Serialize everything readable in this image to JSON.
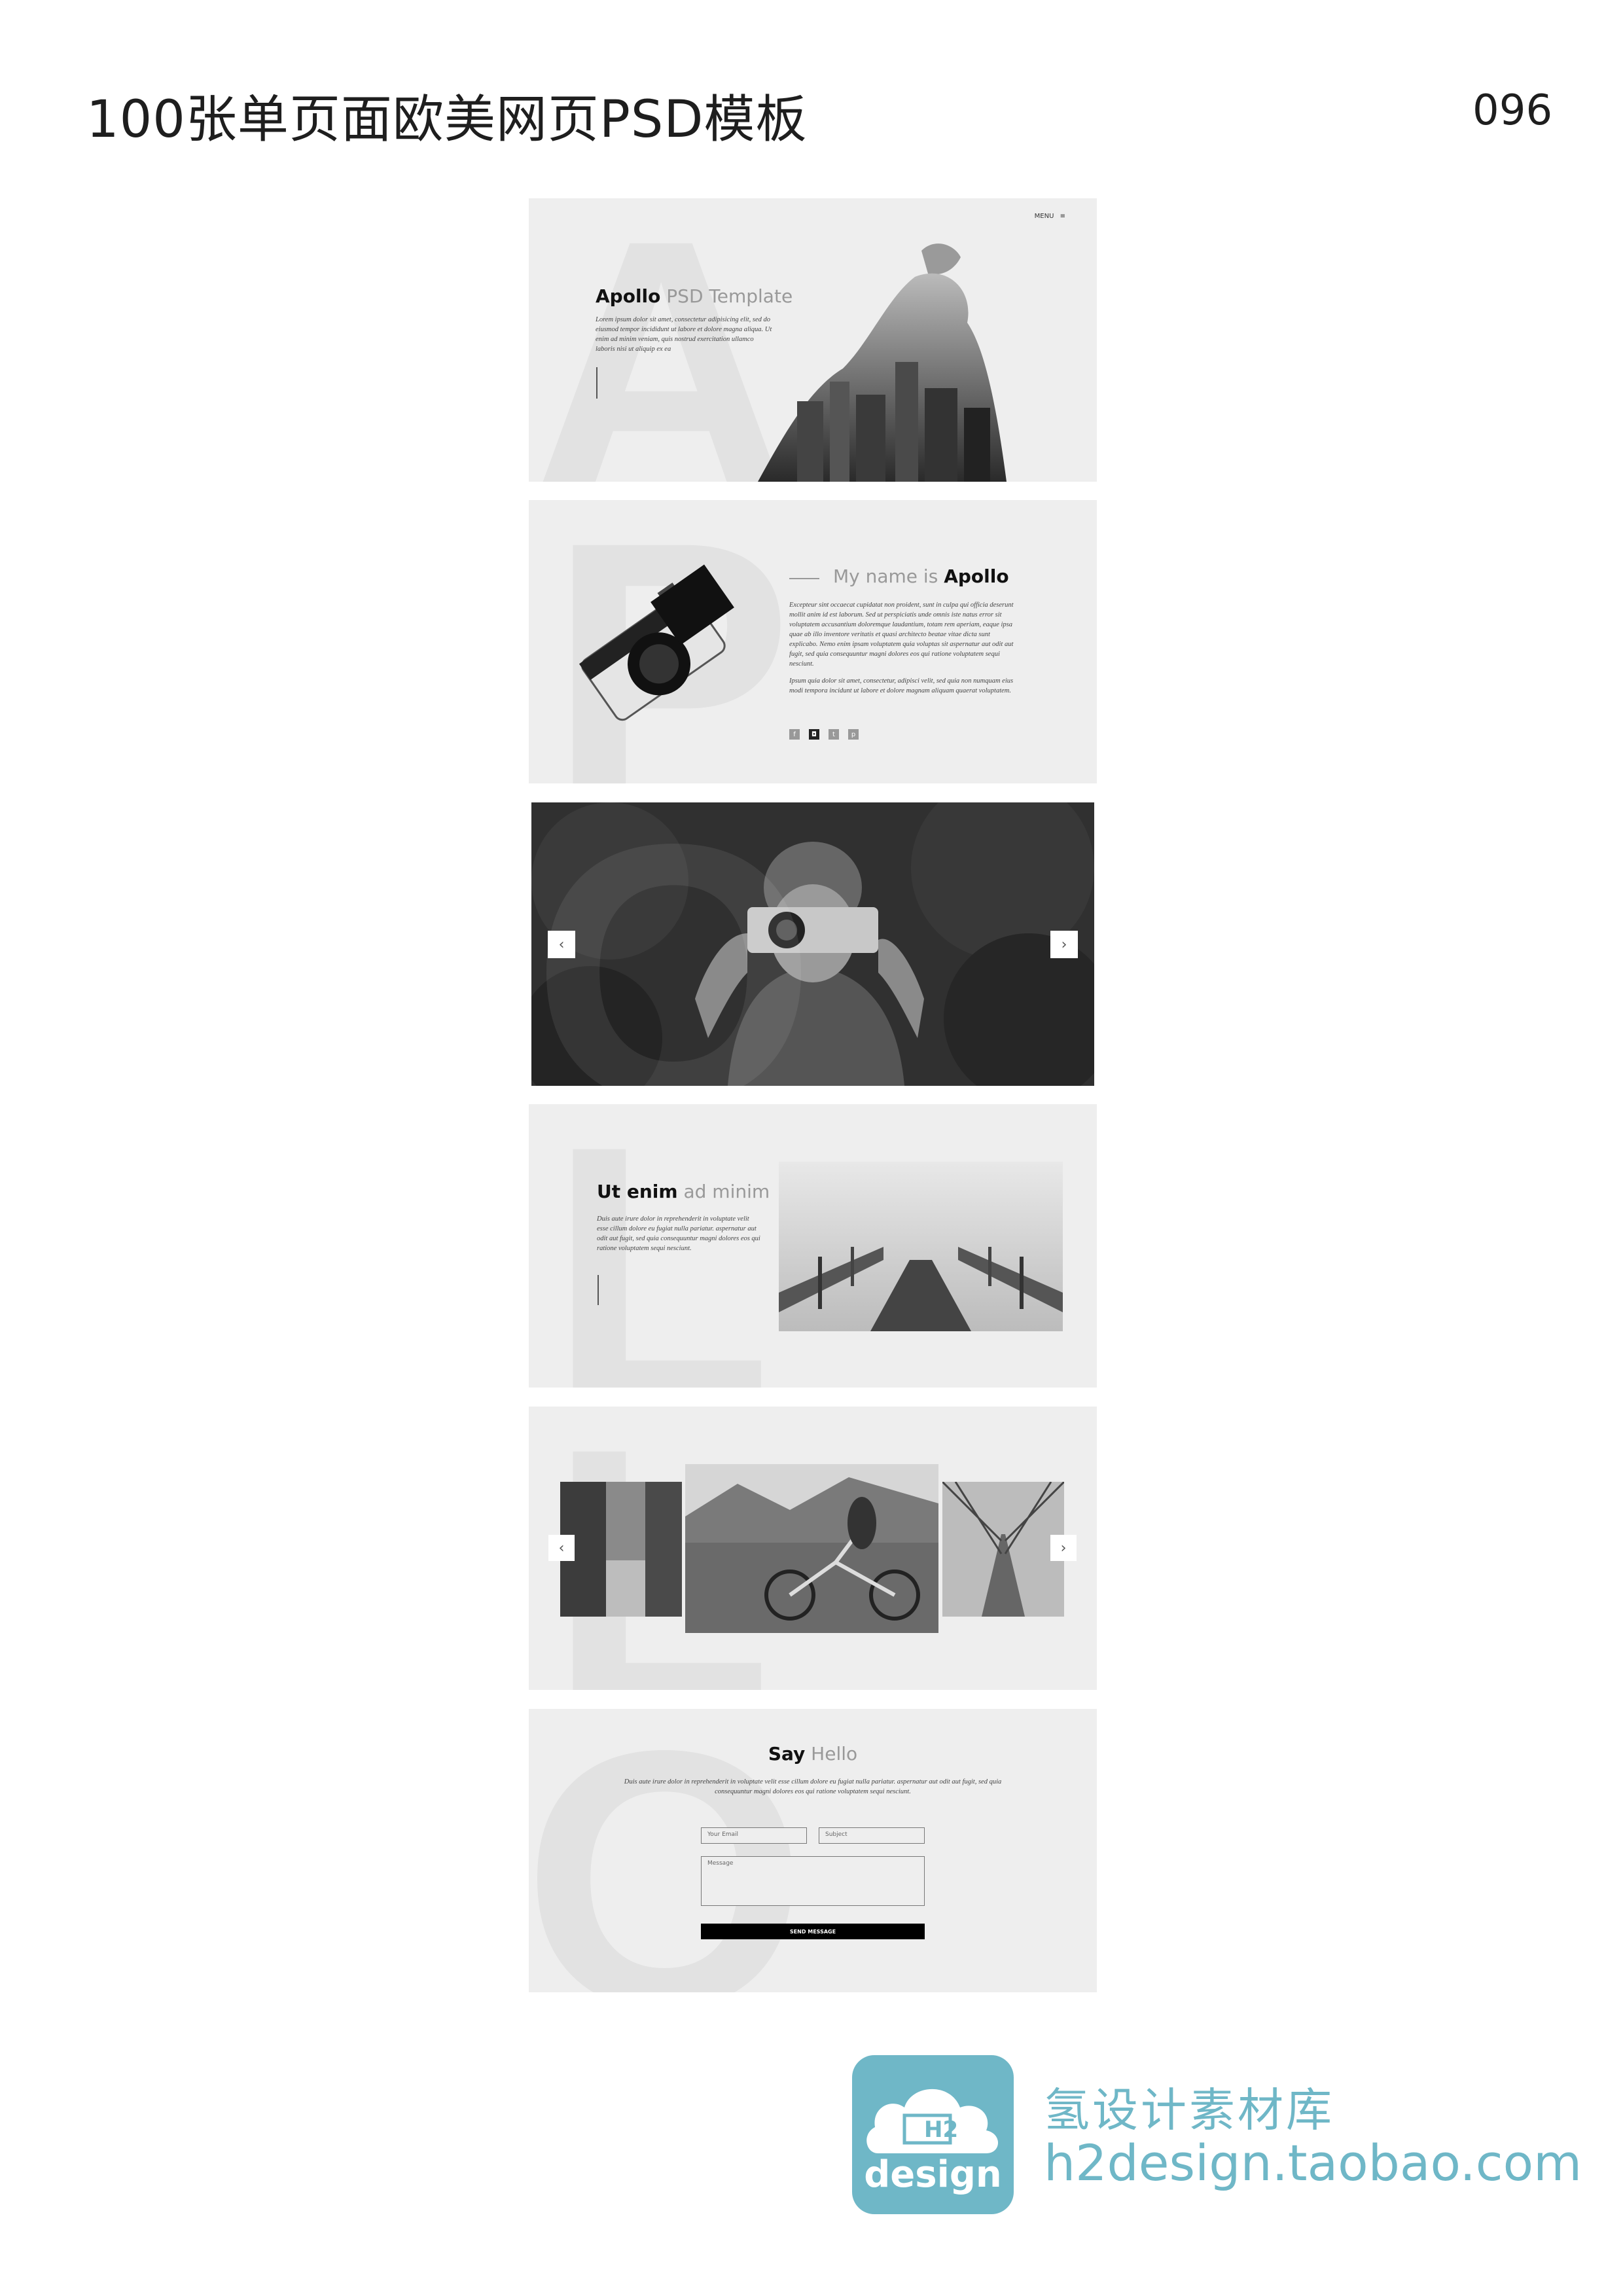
{
  "header": {
    "title": "100张单页面欧美网页PSD模板",
    "number": "096"
  },
  "hero": {
    "menu_label": "MENU",
    "title_bold": "Apollo",
    "title_light": " PSD Template",
    "text": "Lorem ipsum dolor sit amet, consectetur adipisicing elit, sed do eiusmod tempor incididunt ut labore et dolore magna aliqua. Ut enim ad minim veniam, quis nostrud exercitation ullamco laboris nisi ut aliquip ex ea",
    "big_letter": "A"
  },
  "about": {
    "title_light": "My name is ",
    "title_bold": "Apollo",
    "text1": "Excepteur sint occaecat cupidatat non proident, sunt in culpa qui officia deserunt mollit anim id est laborum. Sed ut perspiciatis unde omnis iste natus error sit voluptatem accusantium doloremque laudantium, totam rem aperiam, eaque ipsa quae ab illo inventore veritatis et quasi architecto beatae vitae dicta sunt explicabo. Nemo enim ipsam voluptatem quia voluptas sit aspernatur aut odit aut fugit, sed quia consequuntur magni dolores eos qui ratione voluptatem sequi nesciunt.",
    "text2": "Ipsum quia dolor sit amet, consectetur, adipisci velit, sed quia non numquam eius modi tempora incidunt ut labore et dolore magnam aliquam quaerat voluptatem.",
    "big_letter": "P",
    "social": [
      "f",
      "◘",
      "t",
      "p"
    ]
  },
  "slider": {
    "big_letter": "O",
    "prev": "‹",
    "next": "›"
  },
  "feature": {
    "title_bold": "Ut enim",
    "title_light": " ad minim",
    "text": "Duis aute irure dolor in reprehenderit in voluptate velit esse cillum dolore eu fugiat nulla pariatur. aspernatur aut odit aut fugit, sed quia consequuntur magni dolores eos qui ratione voluptatem sequi nesciunt.",
    "big_letter": "L"
  },
  "gallery": {
    "big_letter": "L",
    "prev": "‹",
    "next": "›"
  },
  "contact": {
    "title_bold": "Say",
    "title_light": " Hello",
    "text": "Duis aute irure dolor in reprehenderit in voluptate velit esse cillum dolore eu fugiat nulla pariatur. aspernatur aut odit aut fugit, sed quia consequuntur magni dolores eos qui ratione voluptatem sequi nesciunt.",
    "email_placeholder": "Your Email",
    "subject_placeholder": "Subject",
    "message_placeholder": "Message",
    "button": "SEND MESSAGE",
    "big_letter": "O"
  },
  "footer": {
    "brand_cn": "氢设计素材库",
    "brand_url": "h2design.taobao.com",
    "logo_text": "design",
    "logo_mark": "H2"
  }
}
